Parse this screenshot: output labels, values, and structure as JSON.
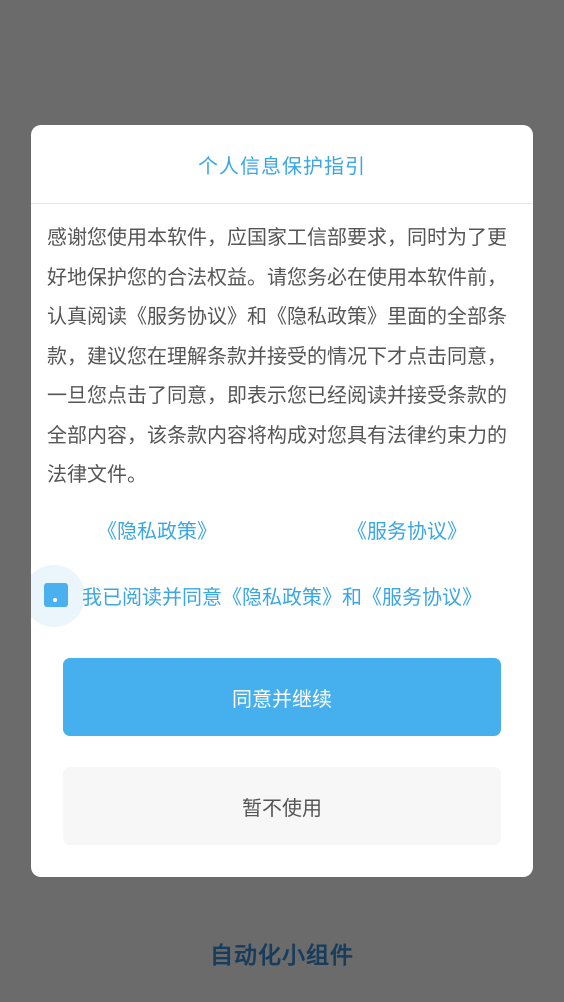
{
  "app": {
    "background_title": "自动化小组件"
  },
  "dialog": {
    "title": "个人信息保护指引",
    "body": "感谢您使用本软件，应国家工信部要求，同时为了更好地保护您的合法权益。请您务必在使用本软件前，认真阅读《服务协议》和《隐私政策》里面的全部条款，建议您在理解条款并接受的情况下才点击同意，一旦您点击了同意，即表示您已经阅读并接受条款的全部内容，该条款内容将构成对您具有法律约束力的法律文件。",
    "links": {
      "privacy": "《隐私政策》",
      "service": "《服务协议》"
    },
    "consent": {
      "label": "我已阅读并同意《隐私政策》和《服务协议》",
      "checked": true
    },
    "buttons": {
      "agree": "同意并继续",
      "decline": "暂不使用"
    }
  },
  "colors": {
    "accent": "#46afee",
    "link": "#3aa6e6",
    "overlay": "#6b6b6b",
    "background_title": "#173c5c"
  }
}
